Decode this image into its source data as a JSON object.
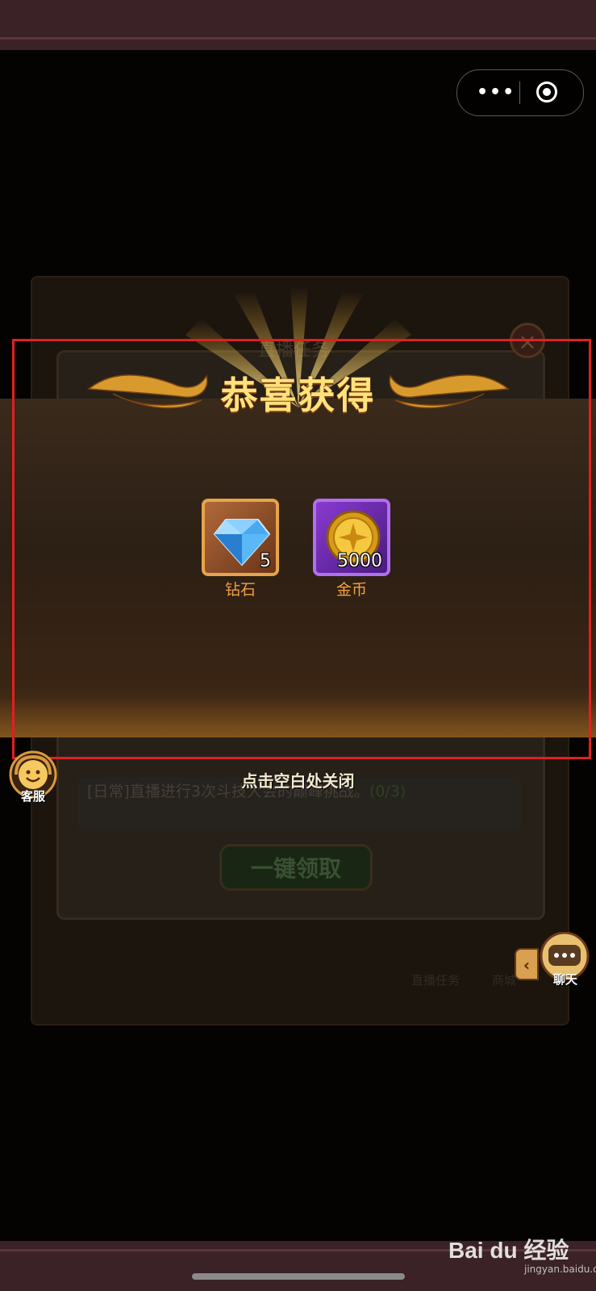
{
  "capsule": {
    "more_icon": "more-dots-icon",
    "close_icon": "target-circle-icon",
    "more_glyph": "•••"
  },
  "background_panel": {
    "tab_title": "直播任务",
    "task_text_prefix": "[日常]直播进行3次斗技大会的巅峰挑战。",
    "task_progress": "(0/3)",
    "claim_all_button": "一键领取",
    "nav_live_tasks": "直播任务",
    "nav_shop": "商城",
    "close_glyph": "×"
  },
  "reward_popup": {
    "title": "恭喜获得",
    "items": [
      {
        "name": "钻石",
        "count": "5",
        "icon": "diamond-icon"
      },
      {
        "name": "金币",
        "count": "5000",
        "icon": "gold-coin-icon"
      }
    ],
    "close_hint": "点击空白处关闭"
  },
  "side_buttons": {
    "customer_service": "客服",
    "chat": "聊天",
    "chat_arrow": "‹"
  },
  "watermark": {
    "brand": "Bai du 经验",
    "domain": "jingyan.baidu.com"
  },
  "colors": {
    "highlight": "#e02020",
    "title_gold": "#ffe27a",
    "label_orange": "#f0a040"
  }
}
